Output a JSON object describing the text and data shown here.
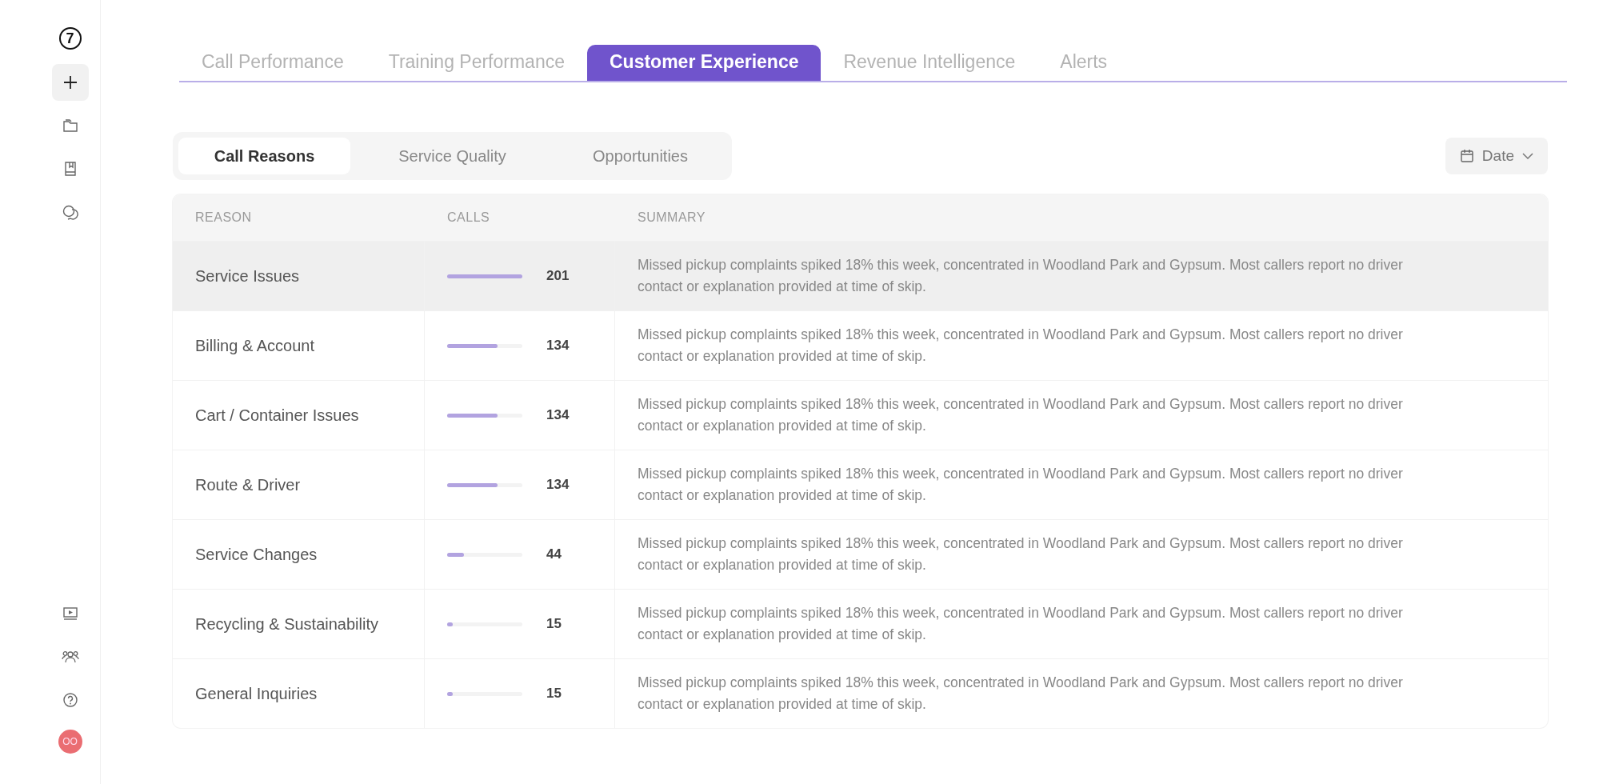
{
  "sidebar": {
    "logo": "7",
    "top_items": [
      {
        "kind": "plus",
        "selected": true
      },
      {
        "kind": "folder",
        "selected": false
      },
      {
        "kind": "book",
        "selected": false
      },
      {
        "kind": "chat",
        "selected": false
      }
    ],
    "bottom_items": [
      {
        "kind": "video"
      },
      {
        "kind": "team"
      },
      {
        "kind": "help"
      }
    ],
    "avatar": "OO"
  },
  "tabs": [
    {
      "label": "Call Performance",
      "selected": false
    },
    {
      "label": "Training Performance",
      "selected": false
    },
    {
      "label": "Customer Experience",
      "selected": true
    },
    {
      "label": "Revenue Intelligence",
      "selected": false
    },
    {
      "label": "Alerts",
      "selected": false
    }
  ],
  "subtabs": [
    {
      "label": "Call Reasons",
      "selected": true
    },
    {
      "label": "Service Quality",
      "selected": false
    },
    {
      "label": "Opportunities",
      "selected": false
    }
  ],
  "date_button": {
    "label": "Date"
  },
  "table": {
    "columns": [
      "REASON",
      "CALLS",
      "SUMMARY"
    ],
    "rows": [
      {
        "reason": "Service Issues",
        "level": 1,
        "calls": "201",
        "summary": "Missed pickup complaints spiked 18% this week, concentrated in Woodland Park and Gypsum. Most callers report no driver contact or explanation provided at time of skip.",
        "highlighted": true
      },
      {
        "reason": "Billing & Account",
        "level": 0.67,
        "calls": "134",
        "summary": "Missed pickup complaints spiked 18% this week, concentrated in Woodland Park and Gypsum. Most callers report no driver contact or explanation provided at time of skip.",
        "highlighted": false
      },
      {
        "reason": "Cart / Container Issues",
        "level": 0.67,
        "calls": "134",
        "summary": "Missed pickup complaints spiked 18% this week, concentrated in Woodland Park and Gypsum. Most callers report no driver contact or explanation provided at time of skip.",
        "highlighted": false
      },
      {
        "reason": "Route & Driver",
        "level": 0.67,
        "calls": "134",
        "summary": "Missed pickup complaints spiked 18% this week, concentrated in Woodland Park and Gypsum. Most callers report no driver contact or explanation provided at time of skip.",
        "highlighted": false
      },
      {
        "reason": "Service Changes",
        "level": 0.22,
        "calls": "44",
        "summary": "Missed pickup complaints spiked 18% this week, concentrated in Woodland Park and Gypsum. Most callers report no driver contact or explanation provided at time of skip.",
        "highlighted": false
      },
      {
        "reason": "Recycling & Sustainability",
        "level": 0.07,
        "calls": "15",
        "summary": "Missed pickup complaints spiked 18% this week, concentrated in Woodland Park and Gypsum. Most callers report no driver contact or explanation provided at time of skip.",
        "highlighted": false
      },
      {
        "reason": "General Inquiries",
        "level": 0.07,
        "calls": "15",
        "summary": "Missed pickup complaints spiked 18% this week, concentrated in Woodland Park and Gypsum. Most callers report no driver contact or explanation provided at time of skip.",
        "highlighted": false
      }
    ]
  }
}
